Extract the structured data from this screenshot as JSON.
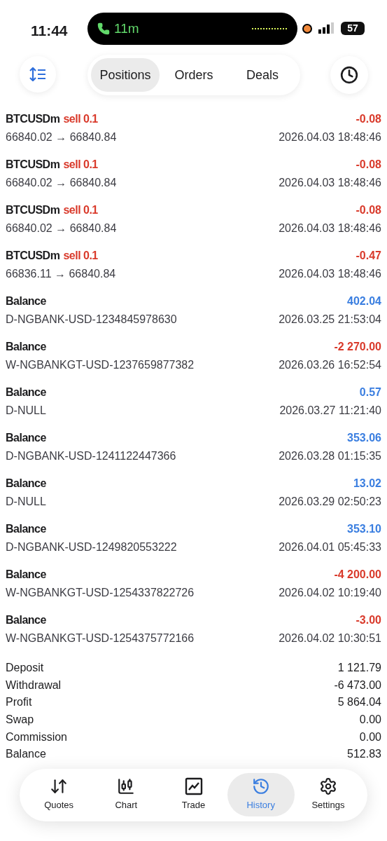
{
  "status_bar": {
    "time": "11:44",
    "call_duration": "11m",
    "battery": "57"
  },
  "toolbar": {
    "tabs": [
      {
        "label": "Positions",
        "selected": true
      },
      {
        "label": "Orders",
        "selected": false
      },
      {
        "label": "Deals",
        "selected": false
      }
    ]
  },
  "rows": [
    {
      "kind": "trade",
      "symbol": "BTCUSDm",
      "side": "sell 0.1",
      "amount": "-0.08",
      "color": "#d93a2b",
      "detail": "66840.02 → 66840.84",
      "time": "2026.04.03 18:48:46"
    },
    {
      "kind": "trade",
      "symbol": "BTCUSDm",
      "side": "sell 0.1",
      "amount": "-0.08",
      "color": "#d93a2b",
      "detail": "66840.02 → 66840.84",
      "time": "2026.04.03 18:48:46"
    },
    {
      "kind": "trade",
      "symbol": "BTCUSDm",
      "side": "sell 0.1",
      "amount": "-0.08",
      "color": "#d93a2b",
      "detail": "66840.02 → 66840.84",
      "time": "2026.04.03 18:48:46"
    },
    {
      "kind": "trade",
      "symbol": "BTCUSDm",
      "side": "sell 0.1",
      "amount": "-0.47",
      "color": "#d93a2b",
      "detail": "66836.11 → 66840.84",
      "time": "2026.04.03 18:48:46"
    },
    {
      "kind": "balance",
      "symbol": "Balance",
      "amount": "402.04",
      "color": "#3a7ee0",
      "detail": "D-NGBANK-USD-1234845978630",
      "time": "2026.03.25 21:53:04"
    },
    {
      "kind": "balance",
      "symbol": "Balance",
      "amount": "-2 270.00",
      "color": "#d93a2b",
      "detail": "W-NGBANKGT-USD-1237659877382",
      "time": "2026.03.26 16:52:54"
    },
    {
      "kind": "balance",
      "symbol": "Balance",
      "amount": "0.57",
      "color": "#3a7ee0",
      "detail": "D-NULL",
      "time": "2026.03.27 11:21:40"
    },
    {
      "kind": "balance",
      "symbol": "Balance",
      "amount": "353.06",
      "color": "#3a7ee0",
      "detail": "D-NGBANK-USD-1241122447366",
      "time": "2026.03.28 01:15:35"
    },
    {
      "kind": "balance",
      "symbol": "Balance",
      "amount": "13.02",
      "color": "#3a7ee0",
      "detail": "D-NULL",
      "time": "2026.03.29 02:50:23"
    },
    {
      "kind": "balance",
      "symbol": "Balance",
      "amount": "353.10",
      "color": "#3a7ee0",
      "detail": "D-NGBANK-USD-1249820553222",
      "time": "2026.04.01 05:45:33"
    },
    {
      "kind": "balance",
      "symbol": "Balance",
      "amount": "-4 200.00",
      "color": "#d93a2b",
      "detail": "W-NGBANKGT-USD-1254337822726",
      "time": "2026.04.02 10:19:40"
    },
    {
      "kind": "balance",
      "symbol": "Balance",
      "amount": "-3.00",
      "color": "#d93a2b",
      "detail": "W-NGBANKGT-USD-1254375772166",
      "time": "2026.04.02 10:30:51"
    }
  ],
  "summary": [
    {
      "label": "Deposit",
      "value": "1 121.79"
    },
    {
      "label": "Withdrawal",
      "value": "-6 473.00"
    },
    {
      "label": "Profit",
      "value": "5 864.04"
    },
    {
      "label": "Swap",
      "value": "0.00"
    },
    {
      "label": "Commission",
      "value": "0.00"
    },
    {
      "label": "Balance",
      "value": "512.83"
    }
  ],
  "nav": [
    {
      "label": "Quotes",
      "selected": false
    },
    {
      "label": "Chart",
      "selected": false
    },
    {
      "label": "Trade",
      "selected": false
    },
    {
      "label": "History",
      "selected": true
    },
    {
      "label": "Settings",
      "selected": false
    }
  ]
}
